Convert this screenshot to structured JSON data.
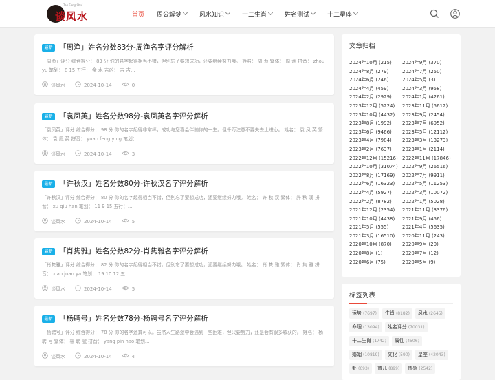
{
  "site": {
    "logo_text": "谈风水",
    "logo_tagline": "Tan Feng Shui"
  },
  "nav": [
    {
      "label": "首页",
      "active": true,
      "has_dropdown": false
    },
    {
      "label": "周公解梦",
      "active": false,
      "has_dropdown": true
    },
    {
      "label": "风水知识",
      "active": false,
      "has_dropdown": true
    },
    {
      "label": "十二生肖",
      "active": false,
      "has_dropdown": true
    },
    {
      "label": "姓名测试",
      "active": false,
      "has_dropdown": true
    },
    {
      "label": "十二星座",
      "active": false,
      "has_dropdown": true
    }
  ],
  "header_icons": [
    "search-icon",
    "user-icon"
  ],
  "colors": {
    "accent": "#e9493a",
    "badge": "#1ab0e8"
  },
  "posts": [
    {
      "badge": "最新",
      "title": "「周渔」姓名分数83分-周渔名字评分解析",
      "excerpt": "「周渔」评分 综合得分： 83 分 你的名字起得相当不错，但别忘了要想成功，还要继续努力哦。 姓名： 周 渔 繁体： 周 漁 拼音： zhou yu 笔划： 8 15 五行： 金 水 吉凶： 吉 吉...",
      "author": "谈风水",
      "date": "2024-10-14",
      "views": "0"
    },
    {
      "badge": "最新",
      "title": "「袁凤英」姓名分数98分-袁凤英名字评分解析",
      "excerpt": "「袁凤英」评分 综合得分： 98 分 你的名字起得非常棒，成功与您喜会伴随你的一生。但千万注意不要失去上进心。 姓名： 袁 凤 英 繁体： 袁 鳳 英 拼音： yuan feng ying 笔划：...",
      "author": "谈风水",
      "date": "2024-10-14",
      "views": "3"
    },
    {
      "badge": "最新",
      "title": "「许秋汉」姓名分数80分-许秋汉名字评分解析",
      "excerpt": "「许秋汉」评分 综合得分： 80 分 你的名字起得相当不错，但别忘了要想成功，还要继续努力哦。 姓名： 许 秋 汉 繁体： 許 秋 漢 拼音： xu qiu han 笔划： 11 9 15 五行：...",
      "author": "谈风水",
      "date": "2024-10-14",
      "views": "5"
    },
    {
      "badge": "最新",
      "title": "「肖隽雅」姓名分数82分-肖隽雅名字评分解析",
      "excerpt": "「肖隽雅」评分 综合得分： 82 分 你的名字起得相当不错，但别忘了要想成功，还要继续努力哦。 姓名： 肖 隽 雅 繁体： 肖 雋 雅 拼音： xiao juan ya 笔划： 19 10 12 五...",
      "author": "谈风水",
      "date": "2024-10-14",
      "views": "5"
    },
    {
      "badge": "最新",
      "title": "「杨聘号」姓名分数78分-杨聘号名字评分解析",
      "excerpt": "「杨聘号」评分 综合得分： 78 分 你的名字还算可以。虽然人生路途中会遇到一些困难，但只要努力，还是会有很多收获的。 姓名： 杨 聘 号 繁体： 楊 聘 號 拼音： yang pin hao 笔划...",
      "author": "谈风水",
      "date": "2024-10-14",
      "views": "4"
    }
  ],
  "archive": {
    "title": "文章归档",
    "items": [
      "2024年10月 (215)",
      "2024年9月 (370)",
      "2024年8月 (279)",
      "2024年7月 (250)",
      "2024年6月 (246)",
      "2024年5月 (3)",
      "2024年4月 (459)",
      "2024年3月 (958)",
      "2024年2月 (2929)",
      "2024年1月 (4261)",
      "2023年12月 (5224)",
      "2023年11月 (5612)",
      "2023年10月 (4432)",
      "2023年9月 (2454)",
      "2023年8月 (1992)",
      "2023年7月 (6952)",
      "2023年6月 (9466)",
      "2023年5月 (12112)",
      "2023年4月 (7984)",
      "2023年3月 (13273)",
      "2023年2月 (7637)",
      "2023年1月 (2114)",
      "2022年12月 (15216)",
      "2022年11月 (17846)",
      "2022年10月 (31074)",
      "2022年9月 (26516)",
      "2022年8月 (17169)",
      "2022年7月 (9911)",
      "2022年6月 (16323)",
      "2022年5月 (11253)",
      "2022年4月 (5927)",
      "2022年3月 (10072)",
      "2022年2月 (8782)",
      "2022年1月 (5028)",
      "2021年12月 (2354)",
      "2021年11月 (3376)",
      "2021年10月 (4438)",
      "2021年9月 (456)",
      "2021年5月 (555)",
      "2021年4月 (5635)",
      "2021年3月 (16510)",
      "2020年11月 (243)",
      "2020年10月 (870)",
      "2020年9月 (20)",
      "2020年8月 (1)",
      "2020年7月 (12)",
      "2020年6月 (75)",
      "2020年5月 (9)"
    ]
  },
  "tags": {
    "title": "标签列表",
    "items": [
      {
        "name": "运势",
        "count": "(7697)"
      },
      {
        "name": "生肖",
        "count": "(8182)"
      },
      {
        "name": "风水",
        "count": "(2645)"
      },
      {
        "name": "命理",
        "count": "(13094)"
      },
      {
        "name": "姓名评分",
        "count": "(70031)"
      },
      {
        "name": "十二生肖",
        "count": "(1742)"
      },
      {
        "name": "属性",
        "count": "(4506)"
      },
      {
        "name": "婚姻",
        "count": "(10819)"
      },
      {
        "name": "文化",
        "count": "(590)"
      },
      {
        "name": "星座",
        "count": "(42043)"
      },
      {
        "name": "卦",
        "count": "(693)"
      },
      {
        "name": "育儿",
        "count": "(899)"
      },
      {
        "name": "情感",
        "count": "(2542)"
      }
    ]
  }
}
